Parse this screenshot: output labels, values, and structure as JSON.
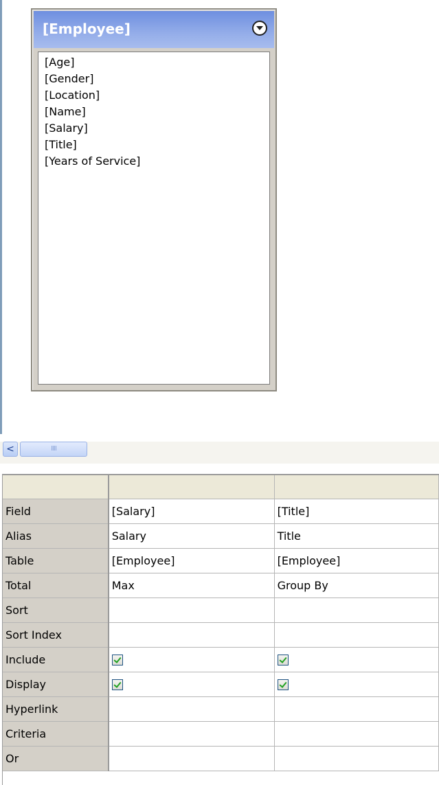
{
  "table_box": {
    "title": "[Employee]",
    "fields": [
      "[Age]",
      "[Gender]",
      "[Location]",
      "[Name]",
      "[Salary]",
      "[Title]",
      "[Years of Service]"
    ]
  },
  "scrollbar": {
    "left_arrow": "<",
    "thumb_grip": "IIII"
  },
  "grid": {
    "rows": [
      {
        "label": "Field",
        "col1": "[Salary]",
        "col2": "[Title]"
      },
      {
        "label": "Alias",
        "col1": "Salary",
        "col2": "Title"
      },
      {
        "label": "Table",
        "col1": "[Employee]",
        "col2": "[Employee]"
      },
      {
        "label": "Total",
        "col1": "Max",
        "col2": "Group By"
      },
      {
        "label": "Sort",
        "col1": "",
        "col2": ""
      },
      {
        "label": "Sort Index",
        "col1": "",
        "col2": ""
      },
      {
        "label": "Include",
        "col1": "",
        "col2": "",
        "checked": [
          true,
          true
        ]
      },
      {
        "label": "Display",
        "col1": "",
        "col2": "",
        "checked": [
          true,
          true
        ]
      },
      {
        "label": "Hyperlink",
        "col1": "",
        "col2": ""
      },
      {
        "label": "Criteria",
        "col1": "",
        "col2": ""
      },
      {
        "label": "Or",
        "col1": "",
        "col2": ""
      }
    ]
  }
}
